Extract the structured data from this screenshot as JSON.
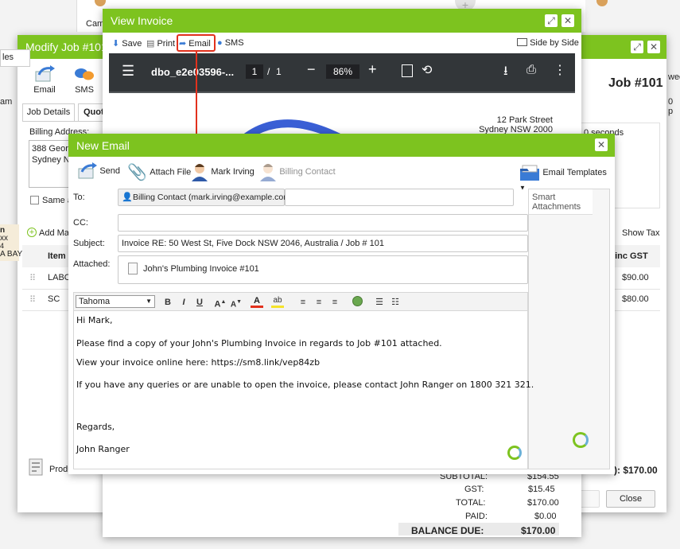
{
  "background_top": {
    "label": "Came"
  },
  "modify_job": {
    "title": "Modify Job #101",
    "tab_left_partial": "les",
    "left_partial_am": "am",
    "email_label": "Email",
    "sms_label": "SMS",
    "tab_job_details": "Job Details",
    "tab_quote_partial": "Quot",
    "billing_address_label": "Billing Address:",
    "billing_address_line1": "388 Georg",
    "billing_address_line2": "Sydney N",
    "same_as_label": "Same a",
    "add_material_label": "Add Mat",
    "col_item": "Item",
    "row1_item": "LABO",
    "row2_item": "SC",
    "left_side_snippets": [
      "n",
      "xx",
      "4",
      "A BAY"
    ],
    "product_label": "Produ",
    "job_number_heading": "Job #101",
    "right_partial_wee": "wee",
    "right_partial_p": "0 p",
    "seconds_text": "0 seconds",
    "show_tax_label": "Show Tax",
    "col_inc_gst": "l inc GST",
    "row1_price": "$90.00",
    "row2_price": "$80.00",
    "total_partial": "): $170.00",
    "close_button": "Close"
  },
  "view_invoice": {
    "title": "View Invoice",
    "toolbar": {
      "save": "Save",
      "print": "Print",
      "email": "Email",
      "sms": "SMS",
      "side_by_side": "Side by Side"
    },
    "pdf": {
      "filename": "dbo_e2e03596-...",
      "page_current": "1",
      "page_separator": "/",
      "page_total": "1",
      "zoom": "86%",
      "address_line1": "12 Park Street",
      "address_line2": "Sydney NSW 2000",
      "subtotal_label": "SUBTOTAL:",
      "subtotal_value": "$154.55",
      "gst_label": "GST:",
      "gst_value": "$15.45",
      "total_label": "TOTAL:",
      "total_value": "$170.00",
      "paid_label": "PAID:",
      "paid_value": "$0.00",
      "balance_label": "BALANCE DUE:",
      "balance_value": "$170.00"
    }
  },
  "new_email": {
    "title": "New Email",
    "toolbar": {
      "send": "Send",
      "attach_file": "Attach File",
      "mark_irving": "Mark Irving",
      "billing_contact": "Billing Contact",
      "email_templates": "Email Templates"
    },
    "to_label": "To:",
    "to_chip": "Billing Contact (mark.irving@example.com)",
    "cc_label": "CC:",
    "subject_label": "Subject:",
    "subject_value": "Invoice RE: 50 West St, Five Dock NSW 2046, Australia / Job # 101",
    "attached_label": "Attached:",
    "attachment_name": "John's Plumbing Invoice #101",
    "smart_attachments_title": "Smart Attachments",
    "editor": {
      "font": "Tahoma",
      "bold": "B",
      "italic": "I",
      "underline": "U"
    },
    "body": {
      "greeting": "Hi Mark,",
      "line1": "Please find a copy of your John's Plumbing Invoice in regards to Job #101 attached.",
      "line2": "View your invoice online here: https://sm8.link/vep84zb",
      "line3": "If you have any queries or are unable to open the invoice, please contact John Ranger on 1800 321 321.",
      "signoff": "Regards,",
      "signature": "John Ranger"
    }
  },
  "colors": {
    "accent_green": "#7dc31f",
    "highlight_red": "#e2311d",
    "pdf_toolbar": "#323639"
  }
}
